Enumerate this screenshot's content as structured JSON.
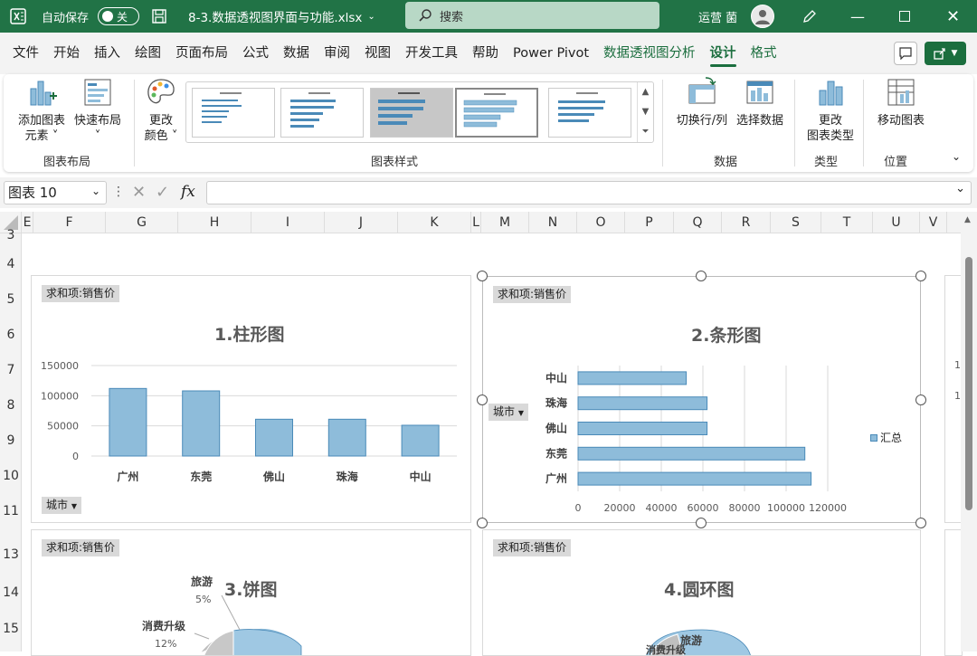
{
  "titlebar": {
    "autosave_label": "自动保存",
    "autosave_state": "关",
    "filename": "8-3.数据透视图界面与功能.xlsx",
    "search_placeholder": "搜索",
    "user": "运营 菌"
  },
  "menu": {
    "items": [
      "文件",
      "开始",
      "插入",
      "绘图",
      "页面布局",
      "公式",
      "数据",
      "审阅",
      "视图",
      "开发工具",
      "帮助",
      "Power Pivot",
      "数据透视图分析",
      "设计",
      "格式"
    ]
  },
  "ribbon": {
    "add_element_1": "添加图表",
    "add_element_2": "元素",
    "quick_layout": "快速布局",
    "change_color_1": "更改",
    "change_color_2": "颜色",
    "switch_rowcol": "切换行/列",
    "select_data": "选择数据",
    "change_type_1": "更改",
    "change_type_2": "图表类型",
    "move_chart": "移动图表",
    "group_layout": "图表布局",
    "group_styles": "图表样式",
    "group_data": "数据",
    "group_type": "类型",
    "group_location": "位置"
  },
  "formula": {
    "namebox": "图表 10",
    "fx": "fx"
  },
  "columns": [
    "E",
    "F",
    "G",
    "H",
    "I",
    "J",
    "K",
    "L",
    "M",
    "N",
    "O",
    "P",
    "Q",
    "R",
    "S",
    "T",
    "U",
    "V"
  ],
  "rows": [
    "3",
    "4",
    "5",
    "6",
    "7",
    "8",
    "9",
    "10",
    "11",
    "13",
    "14",
    "15"
  ],
  "colors": {
    "accent": "#217346",
    "bar_fill": "#8ebcda",
    "bar_stroke": "#4a8ab8"
  },
  "charts": {
    "c1": {
      "field": "求和项:销售价",
      "title": "1.柱形图",
      "axis_field": "城市"
    },
    "c2": {
      "field": "求和项:销售价",
      "title": "2.条形图",
      "axis_field": "城市",
      "legend": "汇总"
    },
    "c3": {
      "field": "求和项:销售价",
      "title": "3.饼图",
      "label_tour": "旅游",
      "label_tour_pct": "5%",
      "label_upgrade": "消费升级",
      "label_upgrade_pct": "12%"
    },
    "c4": {
      "field": "求和项:销售价",
      "title": "4.圆环图",
      "label_tour": "旅游",
      "label_upgrade": "消费升级"
    },
    "right_edge": [
      "1",
      "1"
    ]
  },
  "chart_data": [
    {
      "type": "bar",
      "title": "1.柱形图",
      "categories": [
        "广州",
        "东莞",
        "佛山",
        "珠海",
        "中山"
      ],
      "values": [
        112000,
        108000,
        61000,
        61000,
        51000
      ],
      "ylim": [
        0,
        150000
      ],
      "yticks": [
        0,
        50000,
        100000,
        150000
      ]
    },
    {
      "type": "bar",
      "orientation": "horizontal",
      "title": "2.条形图",
      "categories": [
        "广州",
        "东莞",
        "佛山",
        "珠海",
        "中山"
      ],
      "values": [
        112000,
        109000,
        62000,
        62000,
        52000
      ],
      "xlim": [
        0,
        120000
      ],
      "xticks": [
        0,
        20000,
        40000,
        60000,
        80000,
        100000,
        120000
      ],
      "legend": [
        "汇总"
      ],
      "legend_position": "right"
    }
  ]
}
